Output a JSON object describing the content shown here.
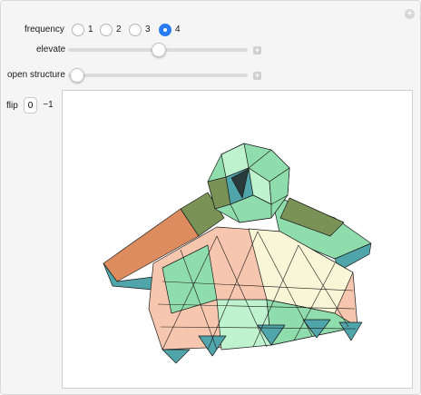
{
  "controls": {
    "frequency": {
      "label": "frequency",
      "options": [
        "1",
        "2",
        "3",
        "4"
      ],
      "selected_index": 3
    },
    "elevate": {
      "label": "elevate",
      "value_fraction": 0.5
    },
    "open_structure": {
      "label": "open structure",
      "value_fraction": 0.0
    },
    "flip": {
      "label": "flip",
      "options": [
        "0",
        "−1"
      ],
      "selected_index": 0
    }
  },
  "icons": {
    "corner": "plus-icon",
    "slider_button": "plus-icon"
  },
  "colors": {
    "accent": "#2a7cf6",
    "face_green": "#8fdcac",
    "face_mint": "#bff3cf",
    "face_peach": "#f6c7ae",
    "face_yellow": "#f9f6d8",
    "face_teal": "#4fa5a9",
    "face_olive": "#7a9256",
    "face_orange": "#dd8c60",
    "edge": "#1a1a1a"
  }
}
